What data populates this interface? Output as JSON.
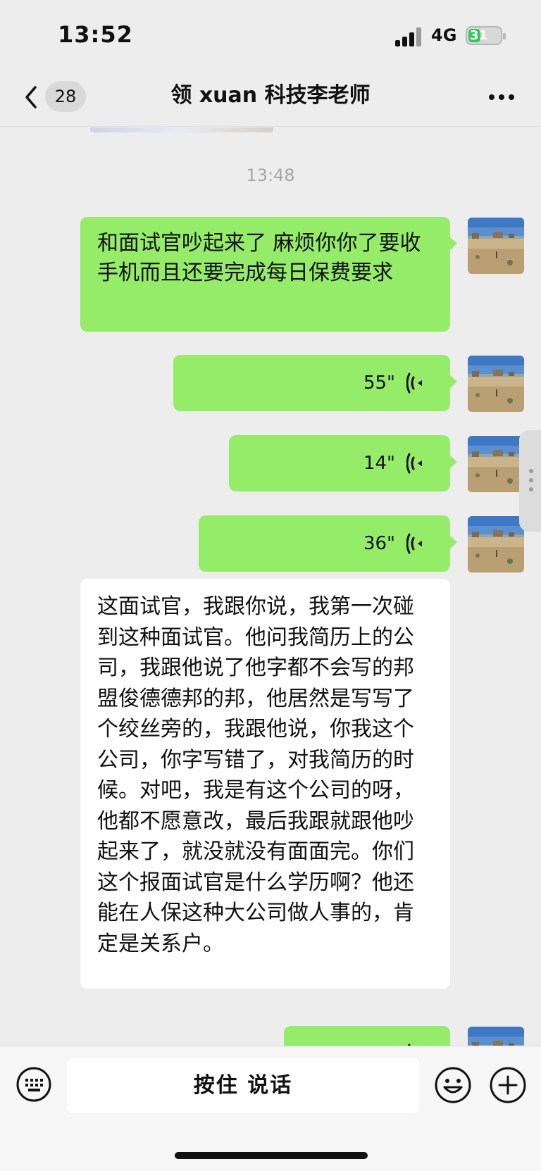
{
  "status_bar": {
    "time": "13:52",
    "network": "4G",
    "battery": "31"
  },
  "nav": {
    "unread_count": "28",
    "title": "领 xuan 科技李老师",
    "back_icon": "chevron-left-icon",
    "more_icon": "more-dots-icon"
  },
  "chat": {
    "timestamp": "13:48",
    "messages": [
      {
        "type": "text",
        "from": "me",
        "text": "和面试官吵起来了 麻烦你你了要收手机而且还要完成每日保费要求"
      },
      {
        "type": "voice",
        "from": "me",
        "duration": "55\""
      },
      {
        "type": "voice",
        "from": "me",
        "duration": "14\""
      },
      {
        "type": "voice",
        "from": "me",
        "duration": "36\""
      },
      {
        "type": "text",
        "from": "other",
        "text": "这面试官，我跟你说，我第一次碰到这种面试官。他问我简历上的公司，我跟他说了他字都不会写的邦盟俊德德邦的邦，他居然是写写了个绞丝旁的，我跟他说，你我这个公司，你字写错了，对我简历的时候。对吧，我是有这个公司的呀，他都不愿意改，最后我跟就跟他吵起来了，就没就没有面面完。你们这个报面试官是什么学历啊？他还能在人保这种大公司做人事的，肯定是关系户。"
      },
      {
        "type": "voice",
        "from": "me",
        "duration": ""
      }
    ]
  },
  "input_bar": {
    "talk_label": "按住 说话"
  },
  "colors": {
    "sent_bubble": "#95ec69",
    "received_bubble": "#ffffff",
    "background": "#ededed"
  }
}
